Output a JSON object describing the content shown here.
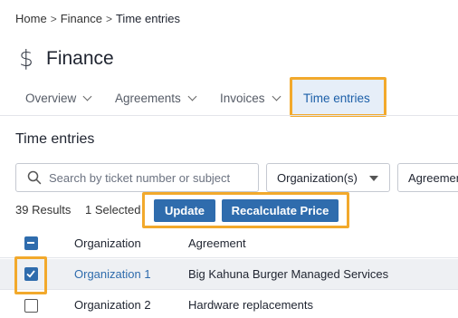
{
  "breadcrumb": {
    "items": [
      "Home",
      "Finance"
    ],
    "current": "Time entries",
    "separator": ">"
  },
  "header": {
    "icon": "dollar-icon",
    "icon_glyph": "$",
    "title": "Finance"
  },
  "tabs": [
    {
      "label": "Overview",
      "has_dropdown": true,
      "active": false
    },
    {
      "label": "Agreements",
      "has_dropdown": true,
      "active": false
    },
    {
      "label": "Invoices",
      "has_dropdown": true,
      "active": false
    },
    {
      "label": "Time entries",
      "has_dropdown": false,
      "active": true
    }
  ],
  "section": {
    "title": "Time entries"
  },
  "filters": {
    "search_placeholder": "Search by ticket number or subject",
    "organization_label": "Organization(s)",
    "agreement_label": "Agreement"
  },
  "toolbar": {
    "results": "39 Results",
    "selected": "1 Selected",
    "update_label": "Update",
    "recalculate_label": "Recalculate Price"
  },
  "table": {
    "columns": [
      "Organization",
      "Agreement"
    ],
    "rows": [
      {
        "organization": "Organization 1",
        "agreement": "Big Kahuna Burger Managed Services",
        "checked": true
      },
      {
        "organization": "Organization 2",
        "agreement": "Hardware replacements",
        "checked": false
      }
    ]
  },
  "colors": {
    "accent": "#2f6cad",
    "highlight": "#f2a92c",
    "link": "#2f6cad"
  }
}
